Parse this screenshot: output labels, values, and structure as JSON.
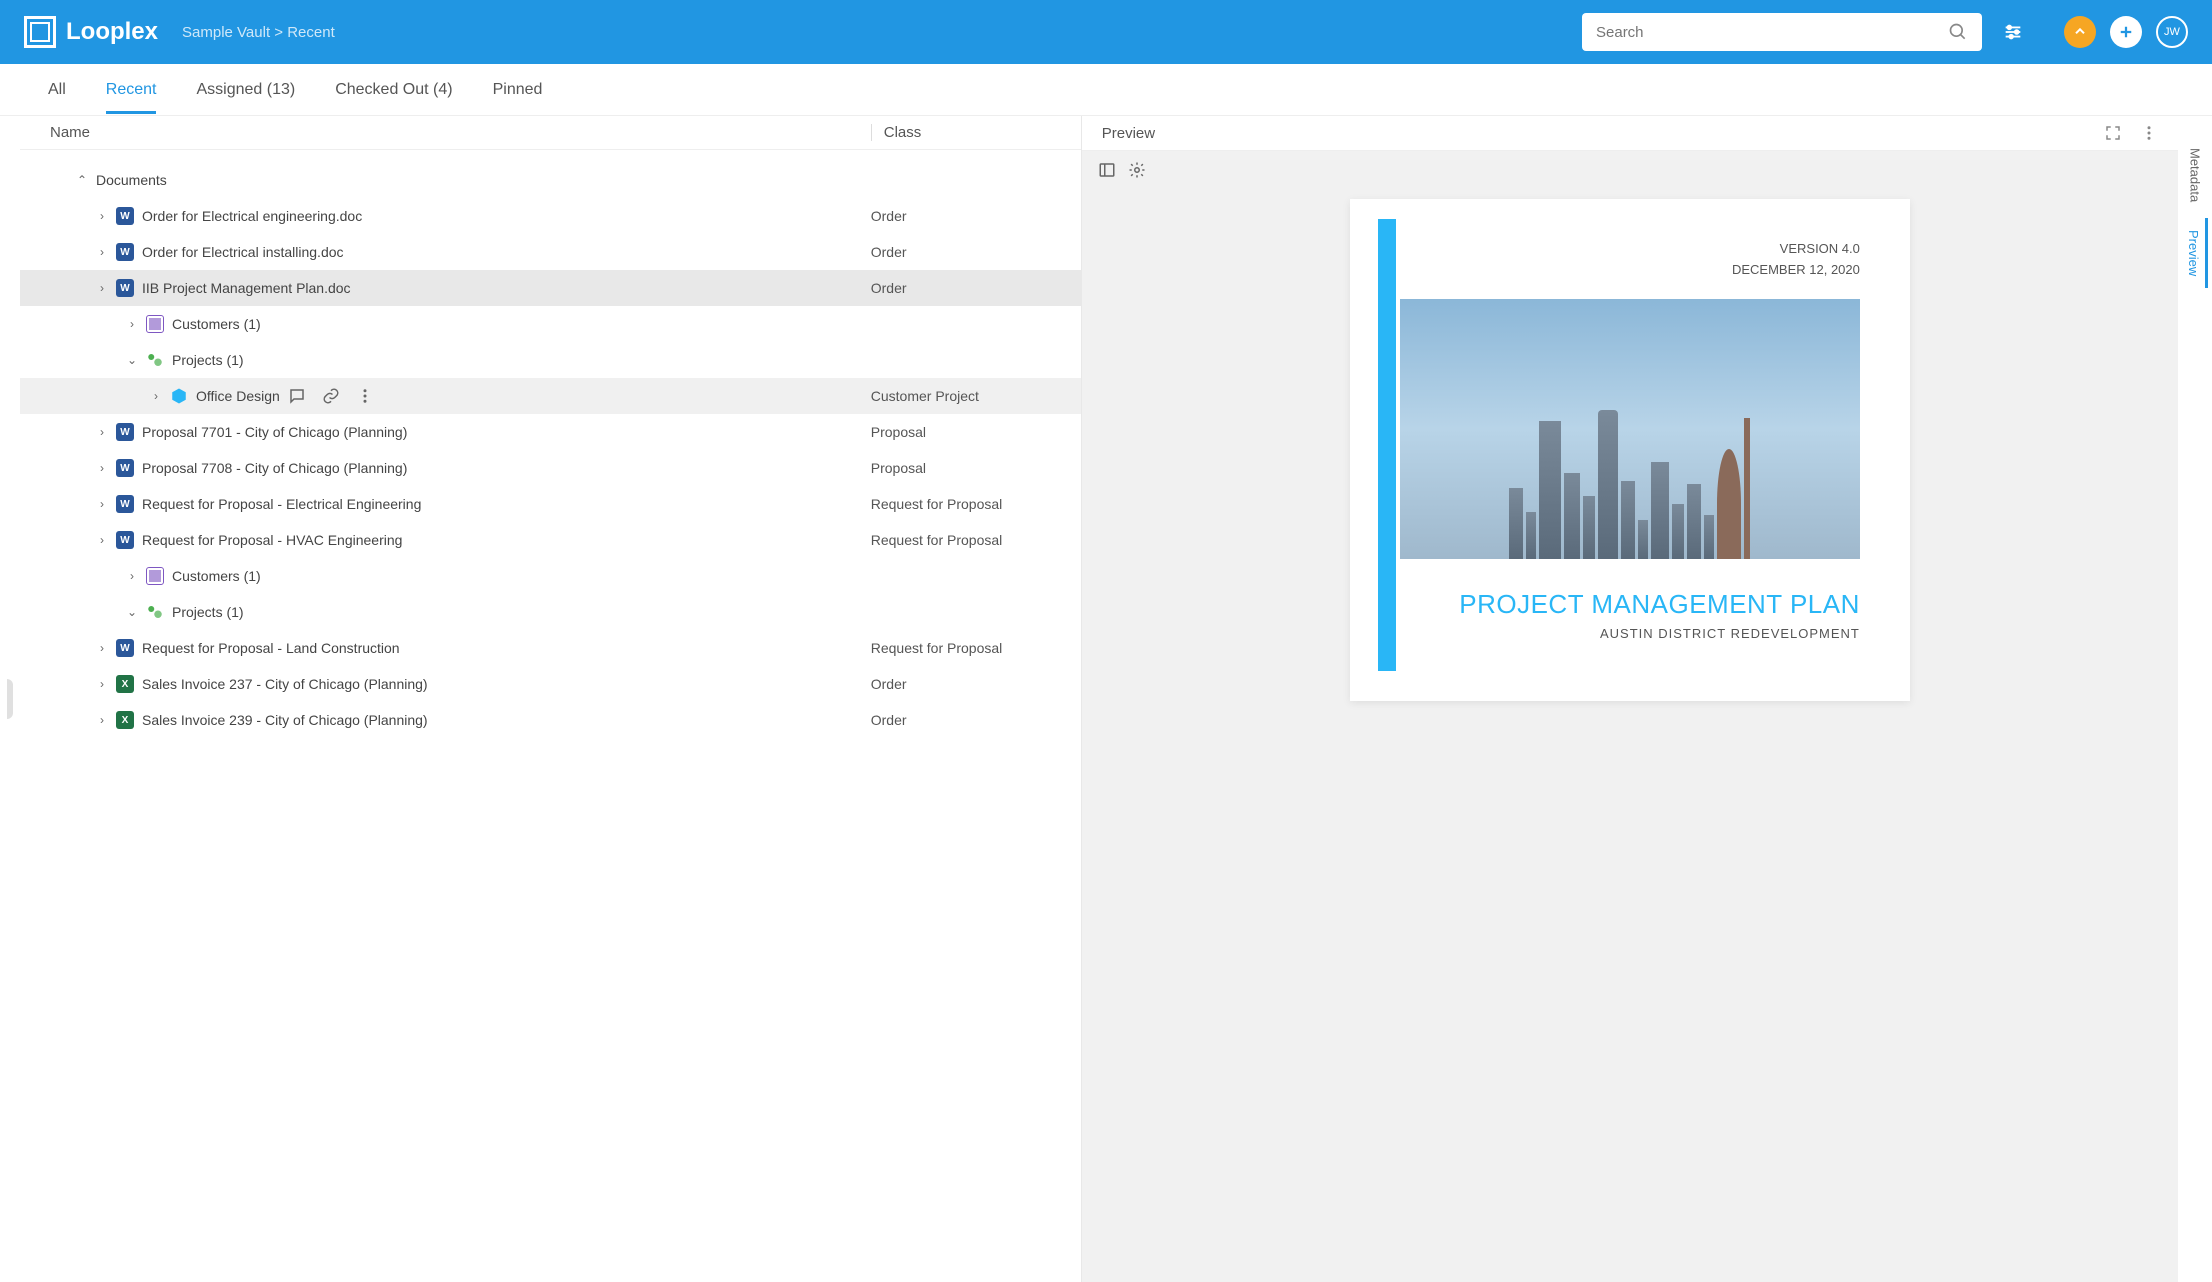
{
  "header": {
    "logo_text": "Looplex",
    "breadcrumb": "Sample Vault > Recent",
    "search_placeholder": "Search",
    "avatar_initials": "JW"
  },
  "tabs": [
    {
      "label": "All",
      "active": false
    },
    {
      "label": "Recent",
      "active": true
    },
    {
      "label": "Assigned (13)",
      "active": false
    },
    {
      "label": "Checked Out (4)",
      "active": false
    },
    {
      "label": "Pinned",
      "active": false
    }
  ],
  "list": {
    "col_name": "Name",
    "col_class": "Class",
    "group_label": "Documents",
    "rows": [
      {
        "name": "Order for Electrical engineering.doc",
        "cls": "Order",
        "icon": "word",
        "indent": 1,
        "chev": ">"
      },
      {
        "name": "Order for Electrical installing.doc",
        "cls": "Order",
        "icon": "word",
        "indent": 1,
        "chev": ">"
      },
      {
        "name": "IIB Project Management Plan.doc",
        "cls": "Order",
        "icon": "word",
        "indent": 1,
        "chev": ">",
        "selected": true
      },
      {
        "name": "Customers (1)",
        "cls": "",
        "icon": "cust",
        "indent": 2,
        "chev": ">"
      },
      {
        "name": "Projects (1)",
        "cls": "",
        "icon": "proj",
        "indent": 2,
        "chev": "v"
      },
      {
        "name": "Office Design",
        "cls": "Customer Project",
        "icon": "box",
        "indent": 3,
        "chev": ">",
        "hovered": true,
        "actions": true
      },
      {
        "name": "Proposal 7701 - City of Chicago (Planning)",
        "cls": "Proposal",
        "icon": "word",
        "indent": 1,
        "chev": ">"
      },
      {
        "name": "Proposal 7708 - City of Chicago (Planning)",
        "cls": "Proposal",
        "icon": "word",
        "indent": 1,
        "chev": ">"
      },
      {
        "name": "Request for Proposal - Electrical Engineering",
        "cls": "Request for Proposal",
        "icon": "word",
        "indent": 1,
        "chev": ">"
      },
      {
        "name": "Request for Proposal - HVAC Engineering",
        "cls": "Request for Proposal",
        "icon": "word",
        "indent": 1,
        "chev": ">"
      },
      {
        "name": "Customers (1)",
        "cls": "",
        "icon": "cust",
        "indent": 2,
        "chev": ">"
      },
      {
        "name": "Projects (1)",
        "cls": "",
        "icon": "proj",
        "indent": 2,
        "chev": "v"
      },
      {
        "name": "Request for Proposal - Land Construction",
        "cls": "Request for Proposal",
        "icon": "word",
        "indent": 1,
        "chev": ">"
      },
      {
        "name": "Sales Invoice 237 - City of Chicago (Planning)",
        "cls": "Order",
        "icon": "excel",
        "indent": 1,
        "chev": ">"
      },
      {
        "name": "Sales Invoice 239 - City of Chicago (Planning)",
        "cls": "Order",
        "icon": "excel",
        "indent": 1,
        "chev": ">"
      }
    ]
  },
  "preview": {
    "title": "Preview",
    "doc_version": "VERSION 4.0",
    "doc_date": "DECEMBER 12, 2020",
    "doc_title": "PROJECT MANAGEMENT PLAN",
    "doc_subtitle": "AUSTIN DISTRICT REDEVELOPMENT"
  },
  "side_tabs": {
    "metadata": "Metadata",
    "preview": "Preview"
  }
}
